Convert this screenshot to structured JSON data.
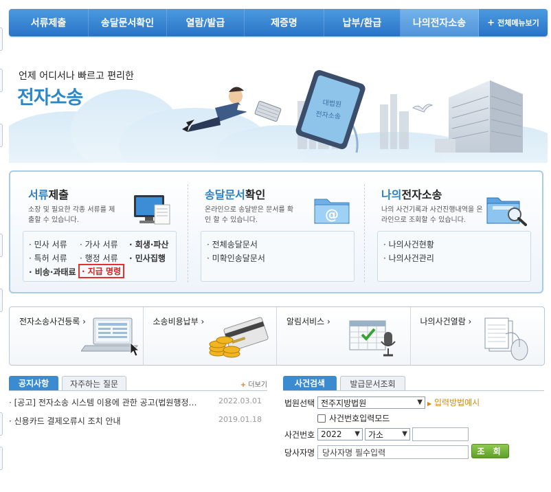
{
  "nav": {
    "items": [
      "서류제출",
      "송달문서확인",
      "열람/발급",
      "제증명",
      "납부/환급",
      "나의전자소송"
    ],
    "active_index": 5,
    "all_menu": "전체메뉴보기"
  },
  "hero": {
    "subtitle": "언제 어디서나 빠르고 편리한",
    "title": "전자소송",
    "tablet_text": "대법원 전자소송"
  },
  "services": [
    {
      "title_hl": "서류",
      "title_rest": "제출",
      "desc": "소장 및 필요한 각종 서류를 제출할 수 있습니다.",
      "links": [
        "· 민사 서류",
        "· 가사 서류",
        "· 회생·파산",
        "· 특허 서류",
        "· 행정 서류",
        "· 민사집행",
        "· 비송·과태료",
        "· 지급 명령"
      ],
      "icon": "monitor-document-icon"
    },
    {
      "title_hl": "송달문서",
      "title_rest": "확인",
      "desc": "온라인으로 송달받은 문서를 확인 할 수 있습니다.",
      "links": [
        "· 전체송달문서",
        "· 미확인송달문서"
      ],
      "icon": "email-folder-icon"
    },
    {
      "title_hl": "나의",
      "title_rest": "전자소송",
      "desc": "나의 사건기록과 사건진행내역을 온라인으로 조회할 수 있습니다.",
      "links": [
        "· 나의사건현황",
        "· 나의사건관리"
      ],
      "icon": "folder-search-icon"
    }
  ],
  "quick": [
    {
      "label": "전자소송사건등록 ›",
      "icon": "laptop-cursor-icon"
    },
    {
      "label": "소송비용납부 ›",
      "icon": "coins-card-icon"
    },
    {
      "label": "알림서비스 ›",
      "icon": "calendar-microphone-icon"
    },
    {
      "label": "나의사건열람 ›",
      "icon": "document-mouse-icon"
    }
  ],
  "notice": {
    "tabs": [
      "공지사항",
      "자주하는 질문"
    ],
    "more": "더보기",
    "items": [
      {
        "title": "· [공고] 전자소송 시스템 이용에 관한 공고(법원행정…",
        "date": "2022.03.01"
      },
      {
        "title": "· 신용카드 결제오류시 조치 안내",
        "date": "2019.01.18"
      }
    ]
  },
  "search": {
    "tabs": [
      "사건검색",
      "발급문서조회"
    ],
    "court_label": "법원선택",
    "court_value": "전주지방법원",
    "guide": "입력방법예시",
    "mode_label": "사건번호입력모드",
    "case_label": "사건번호",
    "year_value": "2022",
    "type_value": "가소",
    "party_label": "당사자명",
    "party_placeholder": "당사자명 필수입력",
    "button": "조 회"
  },
  "colors": {
    "nav_blue": "#2a72c6",
    "accent_blue": "#2d86c5",
    "highlight_red": "#e53030",
    "button_green": "#5c9f28"
  }
}
